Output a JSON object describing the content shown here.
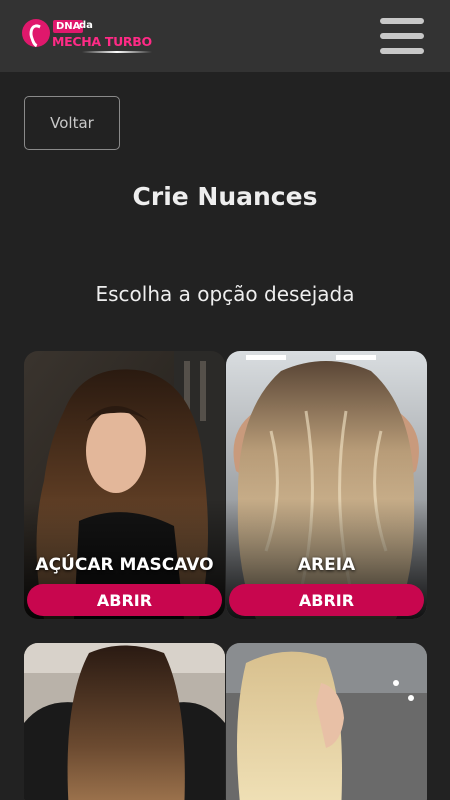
{
  "header": {
    "logo": {
      "badge": "DNA",
      "connector": "da",
      "wordmark": "MECHA TURBO"
    },
    "menu_icon": "hamburger-menu-icon"
  },
  "back_button": {
    "label": "Voltar"
  },
  "page": {
    "title": "Crie Nuances",
    "subtitle": "Escolha a opção desejada"
  },
  "cards": [
    {
      "name": "AÇÚCAR MASCAVO",
      "button": "ABRIR"
    },
    {
      "name": "AREIA",
      "button": "ABRIR"
    },
    {
      "name": "",
      "button": ""
    },
    {
      "name": "",
      "button": ""
    }
  ],
  "colors": {
    "background": "#222222",
    "topbar": "#333333",
    "accent": "#c8064e",
    "logo_pink": "#e0186c"
  }
}
